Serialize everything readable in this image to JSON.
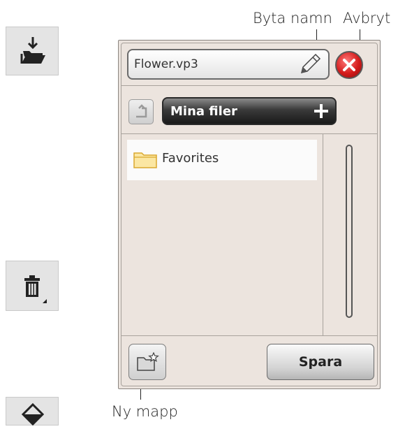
{
  "callouts": {
    "rename": "Byta namn",
    "cancel": "Avbryt",
    "new_folder": "Ny mapp"
  },
  "dialog": {
    "filename": "Flower.vp3",
    "current_folder": "Mina filer",
    "items": [
      {
        "label": "Favorites",
        "icon": "folder-icon"
      }
    ],
    "save_label": "Spara"
  },
  "icons": {
    "side": [
      "open-folder-download-icon",
      "trash-icon",
      "diamond-icon"
    ],
    "rename": "pencil-icon",
    "cancel": "close-icon",
    "up": "folder-up-icon",
    "add": "plus-icon",
    "new_folder": "new-folder-icon"
  },
  "colors": {
    "cancel_red": "#d41c1c",
    "dialog_bg": "#ebe3dd",
    "folder_yellow": "#f2c84b"
  }
}
